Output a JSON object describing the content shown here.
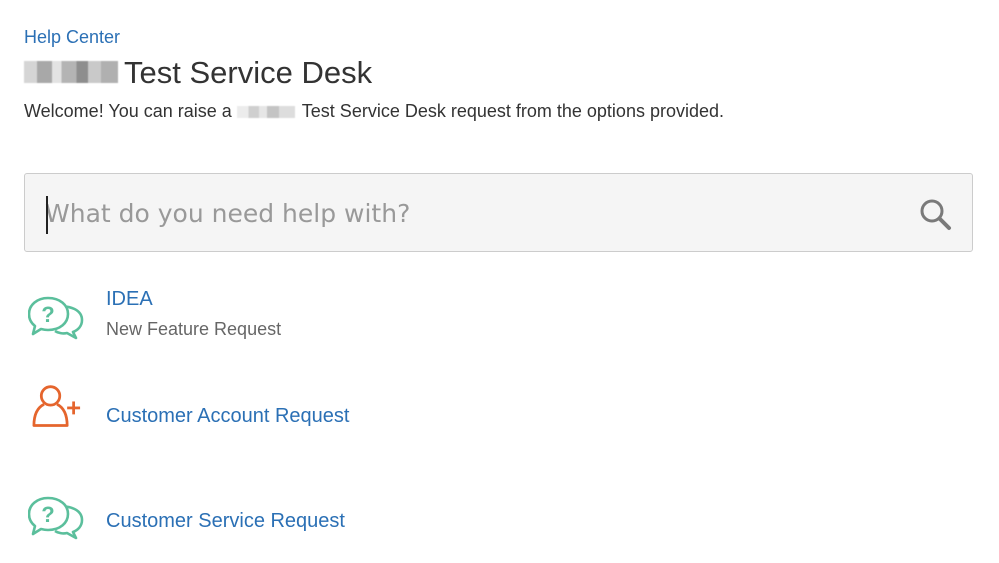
{
  "breadcrumb": {
    "label": "Help Center"
  },
  "header": {
    "title": "Test Service Desk",
    "welcome_before": "Welcome! You can raise a",
    "welcome_after": "Test Service Desk request from the options provided."
  },
  "search": {
    "placeholder": "What do you need help with?",
    "value": ""
  },
  "requests": [
    {
      "name": "IDEA",
      "description": "New Feature Request",
      "icon": "question-chat-bubbles-icon"
    },
    {
      "name": "Customer Account Request",
      "description": "",
      "icon": "add-user-icon"
    },
    {
      "name": "Customer Service Request",
      "description": "",
      "icon": "question-chat-bubbles-icon"
    }
  ],
  "colors": {
    "link": "#2b70b5",
    "chat_icon": "#5bbf9c",
    "user_icon": "#e5652d",
    "text": "#333333",
    "muted": "#666666"
  }
}
